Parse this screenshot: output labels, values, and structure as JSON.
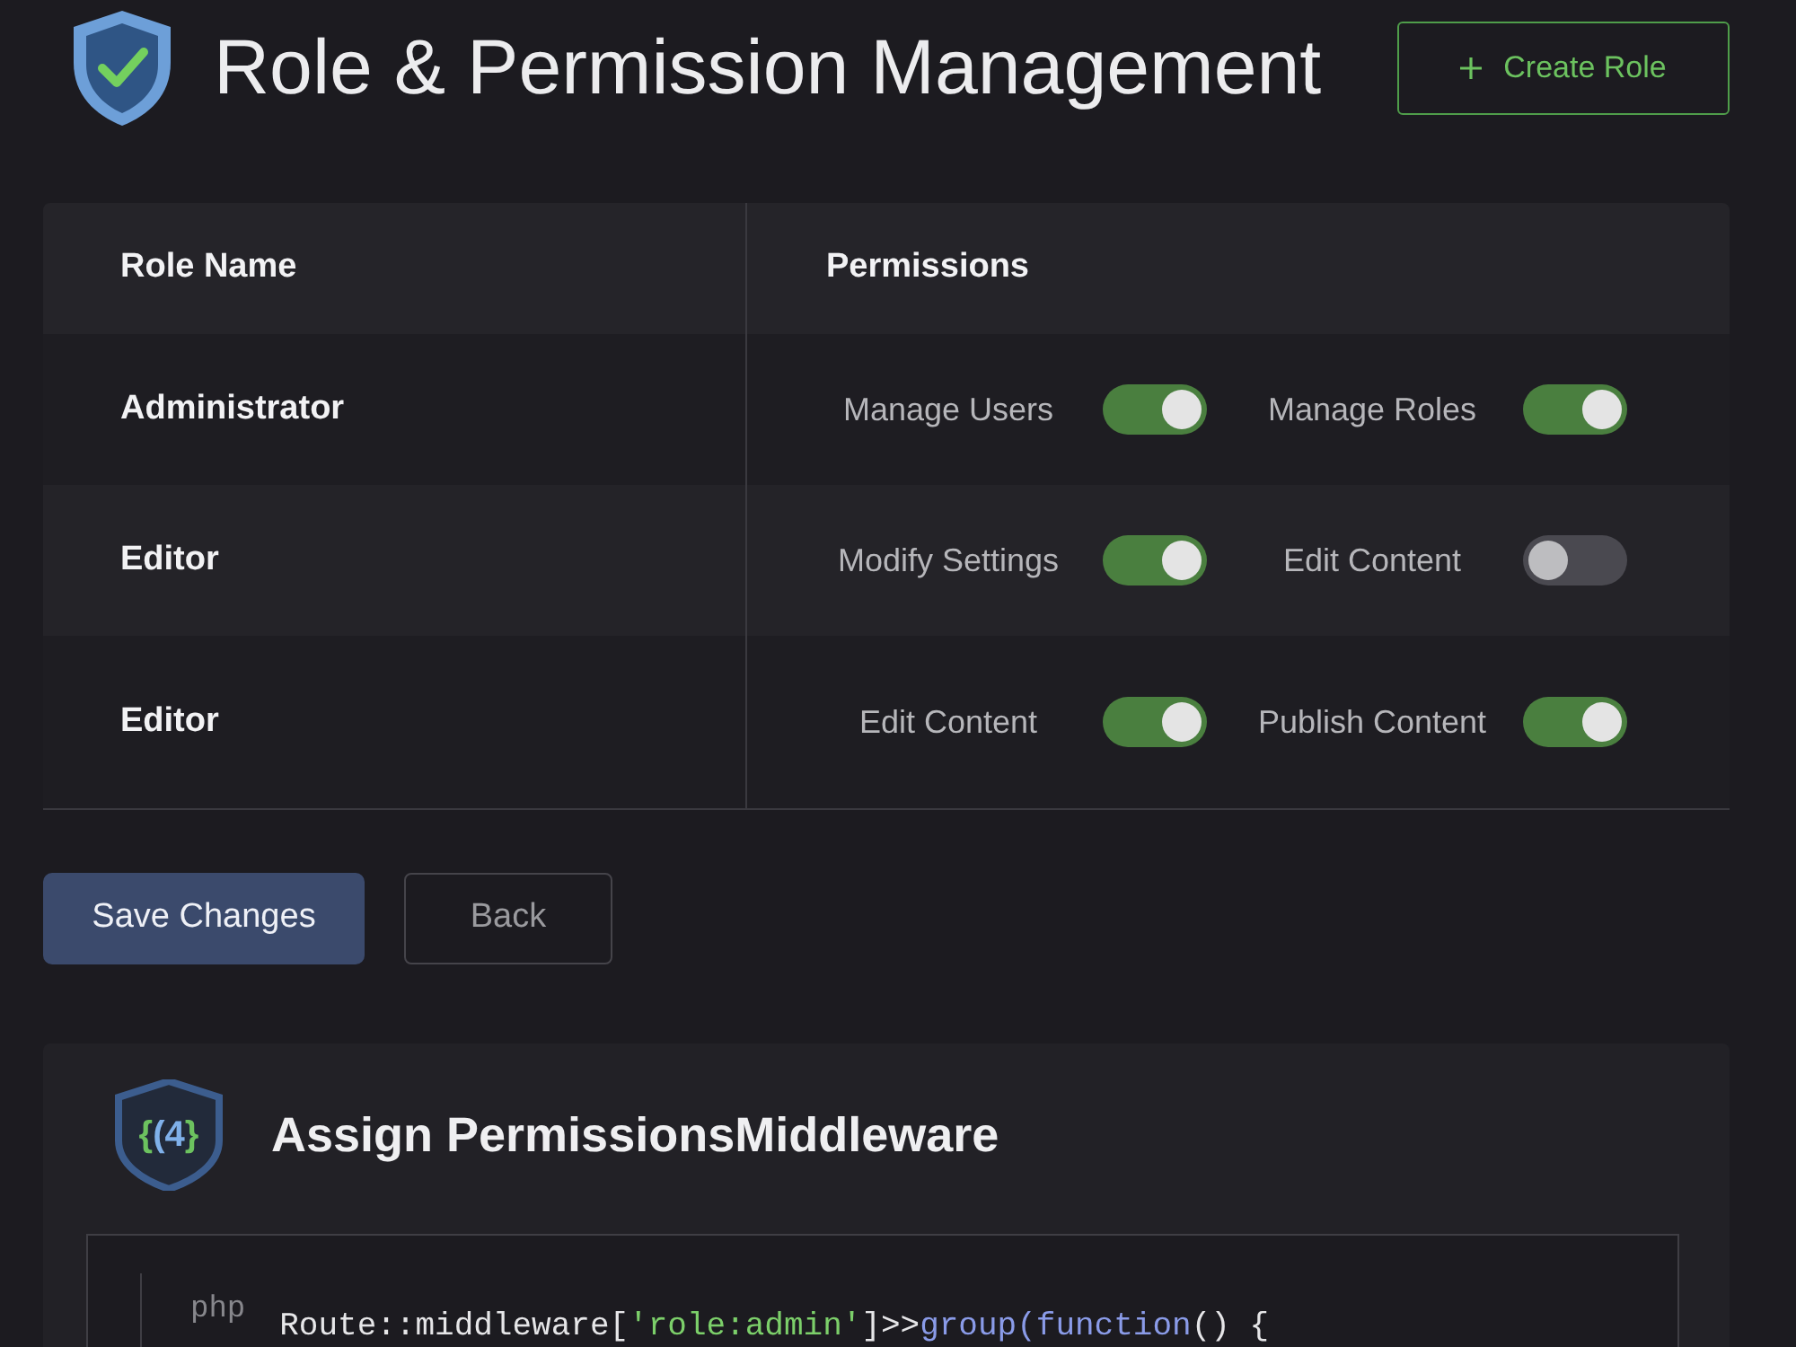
{
  "header": {
    "title": "Role & Permission Management",
    "create_button": {
      "label": "Create Role"
    }
  },
  "table": {
    "columns": [
      "Role Name",
      "Permissions"
    ],
    "rows": [
      {
        "role": "Administrator",
        "permissions": [
          {
            "label": "Manage Users",
            "on": true
          },
          {
            "label": "Manage Roles",
            "on": true
          }
        ]
      },
      {
        "role": "Editor",
        "permissions": [
          {
            "label": "Modify Settings",
            "on": true
          },
          {
            "label": "Edit Content",
            "on": false
          }
        ]
      },
      {
        "role": "Editor",
        "permissions": [
          {
            "label": "Edit Content",
            "on": true
          },
          {
            "label": "Publish Content",
            "on": true
          }
        ]
      }
    ]
  },
  "actions": [
    {
      "label": "Save Changes",
      "kind": "primary"
    },
    {
      "label": "Back",
      "kind": "secondary"
    }
  ],
  "code_panel": {
    "badge": "{(4}",
    "title": "Assign PermissionsMiddleware",
    "language": "php",
    "lines": [
      [
        {
          "text": "Route::middleware[",
          "kind": "plain"
        },
        {
          "text": "'role:admin'",
          "kind": "string"
        },
        {
          "text": "]>>",
          "kind": "plain"
        },
        {
          "text": "group(function",
          "kind": "keyword"
        },
        {
          "text": "() {",
          "kind": "plain"
        }
      ]
    ]
  }
}
